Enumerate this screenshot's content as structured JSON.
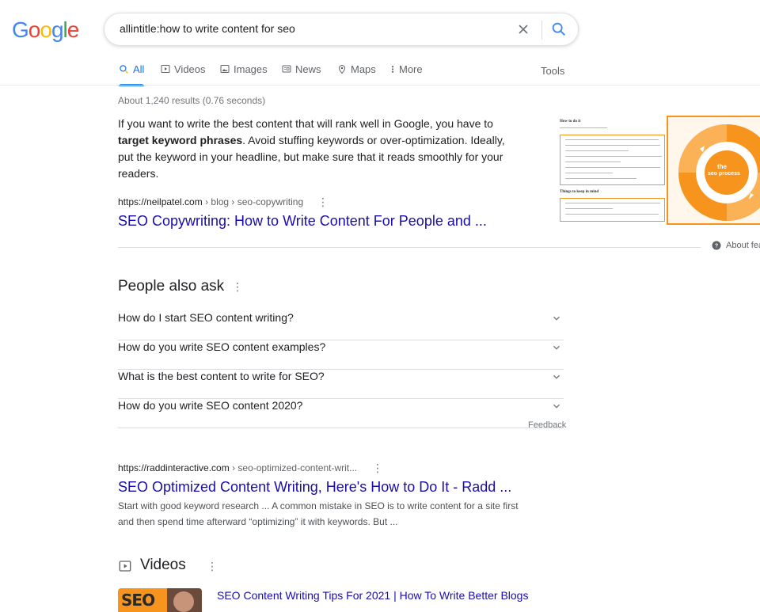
{
  "logo": {
    "text": "Google"
  },
  "search": {
    "query": "allintitle:how to write content for seo"
  },
  "tabs": [
    {
      "label": "All",
      "icon": "search-icon"
    },
    {
      "label": "Videos",
      "icon": "video-play-icon"
    },
    {
      "label": "Images",
      "icon": "image-icon"
    },
    {
      "label": "News",
      "icon": "news-icon"
    },
    {
      "label": "Maps",
      "icon": "map-pin-icon"
    },
    {
      "label": "More",
      "icon": "more-vertical-icon"
    }
  ],
  "tools_label": "Tools",
  "result_stats": "About 1,240 results (0.76 seconds)",
  "featured_snippet": {
    "text_before": "If you want to write the best content that will rank well in Google, you have to ",
    "text_bold": "target keyword phrases",
    "text_after": ". Avoid stuffing keywords or over-optimization. Ideally, put the keyword in your headline, but make sure that it reads smoothly for your readers.",
    "cite_domain": "https://neilpatel.com",
    "cite_path": " › blog › seo-copywriting",
    "title": "SEO Copywriting: How to Write Content For People and ...",
    "image_heading_1": "How to do it",
    "image_heading_2": "Things to keep in mind",
    "image_center_label_1": "the",
    "image_center_label_2": "seo process",
    "about_label": "About fea"
  },
  "people_also_ask": {
    "heading": "People also ask",
    "questions": [
      "How do I start SEO content writing?",
      "How do you write SEO content examples?",
      "What is the best content to write for SEO?",
      "How do you write SEO content 2020?"
    ],
    "feedback_label": "Feedback"
  },
  "result2": {
    "cite_domain": "https://raddinteractive.com",
    "cite_path": " › seo-optimized-content-writ...",
    "title": "SEO Optimized Content Writing, Here's How to Do It - Radd ...",
    "snippet": "Start with good keyword research ... A common mistake in SEO is to write content for a site first and then spend time afterward “optimizing” it with keywords. But ..."
  },
  "videos": {
    "heading": "Videos",
    "items": [
      {
        "title": "SEO Content Writing Tips For 2021 | How To Write Better Blogs",
        "thumb_text": "SEO"
      }
    ]
  },
  "colors": {
    "link": "#1a0dab",
    "accent": "#1a73e8",
    "orange": "#f7941d",
    "google_blue": "#4285f4",
    "google_red": "#ea4335",
    "google_yellow": "#fbbc05",
    "google_green": "#34a853"
  }
}
